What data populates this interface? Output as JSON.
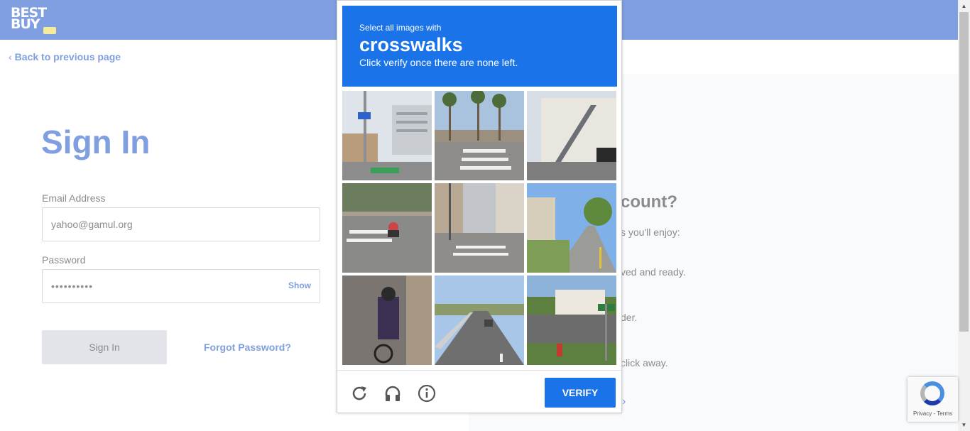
{
  "header": {
    "logo_line1": "BEST",
    "logo_line2": "BUY",
    "brand_color": "#7f9fe0",
    "tag_color": "#f2ec9b"
  },
  "nav": {
    "back_label": "Back to previous page"
  },
  "signin": {
    "title": "Sign In",
    "email_label": "Email Address",
    "email_value": "yahoo@gamul.org",
    "password_label": "Password",
    "password_value": "••••••••••",
    "show_label": "Show",
    "submit_label": "Sign In",
    "forgot_label": "Forgot Password?"
  },
  "account_panel": {
    "title_fragment": "count?",
    "subtitle_fragment": "s you'll enjoy:",
    "benefits": [
      "ved and ready.",
      "der.",
      "click away."
    ]
  },
  "captcha": {
    "instruction": "Select all images with",
    "target": "crosswalks",
    "hint": "Click verify once there are none left.",
    "verify_label": "VERIFY",
    "accent_color": "#1a73e8",
    "footer_icons": [
      "reload-icon",
      "headphones-icon",
      "info-icon"
    ]
  },
  "recaptcha_badge": {
    "text": "Privacy - Terms"
  }
}
